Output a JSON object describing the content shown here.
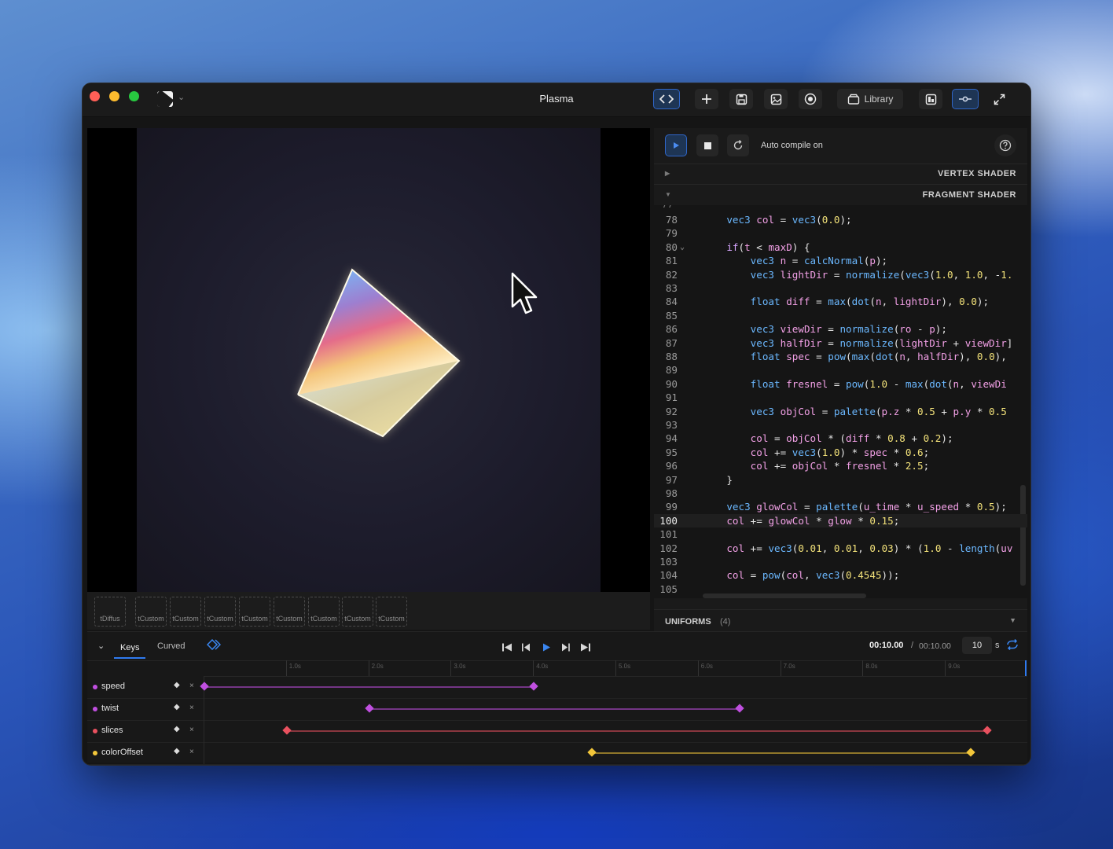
{
  "window": {
    "title": "Plasma"
  },
  "toolbar": {
    "library_label": "Library"
  },
  "editor": {
    "auto_compile_label": "Auto compile on",
    "vertex_label": "VERTEX SHADER",
    "fragment_label": "FRAGMENT SHADER",
    "uniforms_label": "UNIFORMS",
    "uniforms_count": "(4)",
    "current_line": "100",
    "code_lines": [
      {
        "n": "78",
        "html": "    <span class='t'>vec3</span> <span class='v'>col</span> = <span class='fn'>vec3</span>(<span class='num'>0.0</span>);"
      },
      {
        "n": "79",
        "html": ""
      },
      {
        "n": "80",
        "html": "    <span class='k'>if</span>(<span class='v'>t</span> &lt; <span class='v'>maxD</span>) {",
        "fold": true
      },
      {
        "n": "81",
        "html": "        <span class='t'>vec3</span> <span class='v'>n</span> = <span class='fn'>calcNormal</span>(<span class='v'>p</span>);"
      },
      {
        "n": "82",
        "html": "        <span class='t'>vec3</span> <span class='v'>lightDir</span> = <span class='fn'>normalize</span>(<span class='fn'>vec3</span>(<span class='num'>1.0</span>, <span class='num'>1.0</span>, -<span class='num'>1.</span>"
      },
      {
        "n": "83",
        "html": ""
      },
      {
        "n": "84",
        "html": "        <span class='t'>float</span> <span class='v'>diff</span> = <span class='fn'>max</span>(<span class='fn'>dot</span>(<span class='v'>n</span>, <span class='v'>lightDir</span>), <span class='num'>0.0</span>);"
      },
      {
        "n": "85",
        "html": ""
      },
      {
        "n": "86",
        "html": "        <span class='t'>vec3</span> <span class='v'>viewDir</span> = <span class='fn'>normalize</span>(<span class='v'>ro</span> - <span class='v'>p</span>);"
      },
      {
        "n": "87",
        "html": "        <span class='t'>vec3</span> <span class='v'>halfDir</span> = <span class='fn'>normalize</span>(<span class='v'>lightDir</span> + <span class='v'>viewDir</span>]"
      },
      {
        "n": "88",
        "html": "        <span class='t'>float</span> <span class='v'>spec</span> = <span class='fn'>pow</span>(<span class='fn'>max</span>(<span class='fn'>dot</span>(<span class='v'>n</span>, <span class='v'>halfDir</span>), <span class='num'>0.0</span>),"
      },
      {
        "n": "89",
        "html": ""
      },
      {
        "n": "90",
        "html": "        <span class='t'>float</span> <span class='v'>fresnel</span> = <span class='fn'>pow</span>(<span class='num'>1.0</span> - <span class='fn'>max</span>(<span class='fn'>dot</span>(<span class='v'>n</span>, <span class='v'>viewDi</span>"
      },
      {
        "n": "91",
        "html": ""
      },
      {
        "n": "92",
        "html": "        <span class='t'>vec3</span> <span class='v'>objCol</span> = <span class='fn'>palette</span>(<span class='v'>p.z</span> * <span class='num'>0.5</span> + <span class='v'>p.y</span> * <span class='num'>0.5</span>"
      },
      {
        "n": "93",
        "html": ""
      },
      {
        "n": "94",
        "html": "        <span class='v'>col</span> = <span class='v'>objCol</span> * (<span class='v'>diff</span> * <span class='num'>0.8</span> + <span class='num'>0.2</span>);"
      },
      {
        "n": "95",
        "html": "        <span class='v'>col</span> += <span class='fn'>vec3</span>(<span class='num'>1.0</span>) * <span class='v'>spec</span> * <span class='num'>0.6</span>;"
      },
      {
        "n": "96",
        "html": "        <span class='v'>col</span> += <span class='v'>objCol</span> * <span class='v'>fresnel</span> * <span class='num'>2.5</span>;"
      },
      {
        "n": "97",
        "html": "    }"
      },
      {
        "n": "98",
        "html": ""
      },
      {
        "n": "99",
        "html": "    <span class='t'>vec3</span> <span class='v'>glowCol</span> = <span class='fn'>palette</span>(<span class='v'>u_time</span> * <span class='v'>u_speed</span> * <span class='num'>0.5</span>);"
      },
      {
        "n": "100",
        "html": "    <span class='v'>col</span> += <span class='v'>glowCol</span> * <span class='v'>glow</span> * <span class='num'>0.15</span>;"
      },
      {
        "n": "101",
        "html": ""
      },
      {
        "n": "102",
        "html": "    <span class='v'>col</span> += <span class='fn'>vec3</span>(<span class='num'>0.01</span>, <span class='num'>0.01</span>, <span class='num'>0.03</span>) * (<span class='num'>1.0</span> - <span class='fn'>length</span>(<span class='v'>uv</span>"
      },
      {
        "n": "103",
        "html": ""
      },
      {
        "n": "104",
        "html": "    <span class='v'>col</span> = <span class='fn'>pow</span>(<span class='v'>col</span>, <span class='fn'>vec3</span>(<span class='num'>0.4545</span>));"
      },
      {
        "n": "105",
        "html": ""
      }
    ]
  },
  "textures": [
    "tDiffus",
    "tCustom",
    "tCustom",
    "tCustom",
    "tCustom",
    "tCustom",
    "tCustom",
    "tCustom",
    "tCustom"
  ],
  "timeline": {
    "tab_keys": "Keys",
    "tab_curved": "Curved",
    "time_current": "00:10.00",
    "time_separator": "/",
    "time_total": "00:10.00",
    "duration_value": "10",
    "duration_unit": "s",
    "ruler_labels": [
      "1.0s",
      "2.0s",
      "3.0s",
      "4.0s",
      "5.0s",
      "6.0s",
      "7.0s",
      "8.0s",
      "9.0s"
    ],
    "tracks": [
      {
        "name": "speed",
        "color": "#c04fe0",
        "keys": [
          0.0,
          4.0
        ]
      },
      {
        "name": "twist",
        "color": "#c04fe0",
        "keys": [
          2.0,
          6.5
        ]
      },
      {
        "name": "slices",
        "color": "#e9515f",
        "keys": [
          1.0,
          9.5
        ]
      },
      {
        "name": "colorOffset",
        "color": "#f2c63a",
        "keys": [
          4.7,
          9.3
        ]
      }
    ]
  }
}
